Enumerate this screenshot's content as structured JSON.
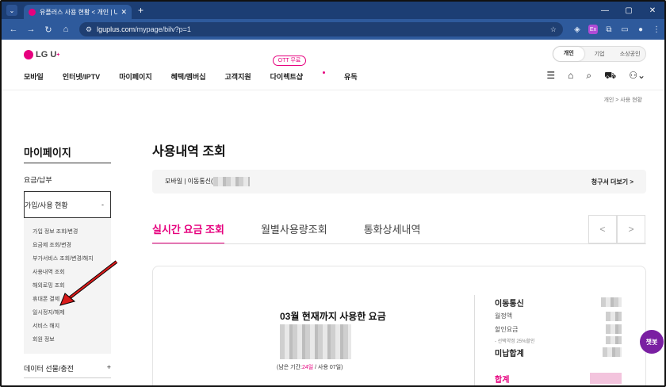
{
  "browser": {
    "tab_title": "유플러스 사용 현황 < 개인 | U",
    "tab_close": "✕",
    "new_tab": "+",
    "url_host": "lguplus.com",
    "url_path": "/mypage/bilv?p=1",
    "window_controls": [
      "—",
      "▢",
      "✕"
    ]
  },
  "site": {
    "logo_text": "LG U",
    "logo_sup": "+",
    "segments": [
      "개인",
      "기업",
      "소상공인"
    ],
    "gnb": [
      "모바일",
      "인터넷/IPTV",
      "마이페이지",
      "혜택/멤버십",
      "고객지원",
      "다이렉트샵",
      "유독"
    ],
    "ott_badge": "OTT 무료",
    "breadcrumb": "개인  >  사용 현황"
  },
  "sidebar": {
    "title": "마이페이지",
    "item_fee": "요금/납부",
    "item_join": "가입/사용 현황",
    "item_join_toggle": "-",
    "sub_items": [
      "가입 정보 조회/변경",
      "요금제 조회/변경",
      "부가서비스 조회/변경/해지",
      "사용내역 조회",
      "해외로밍 조회",
      "휴대폰 결제",
      "일시정지/해제",
      "서비스 해지",
      "회원 정보"
    ],
    "item_data": "데이터 선물/충전",
    "item_data_toggle": "+"
  },
  "main": {
    "title": "사용내역 조회",
    "line_label": "모바일 | 이동통신(",
    "bill_more": "청구서 더보기 >",
    "tabs": [
      "실시간 요금 조회",
      "월별사용량조회",
      "통화상세내역"
    ],
    "prev": "<",
    "next": ">",
    "usage_label": "03월 현재까지 사용한 요금",
    "remaining_prefix": "(남은 기간:",
    "remaining_days": "24일",
    "remaining_suffix": " / 사용 07일)",
    "detail": {
      "carrier": "이동통신",
      "monthly": "월정액",
      "discount": "할인요금",
      "discount_note": "- 선택약정 25%할인",
      "unpaid_total": "미납합계",
      "total": "합계"
    },
    "chatbot": "챗봇"
  },
  "colors": {
    "brand": "#e6007e",
    "chrome": "#2e5a9c",
    "chatbot": "#7a1fa2"
  }
}
